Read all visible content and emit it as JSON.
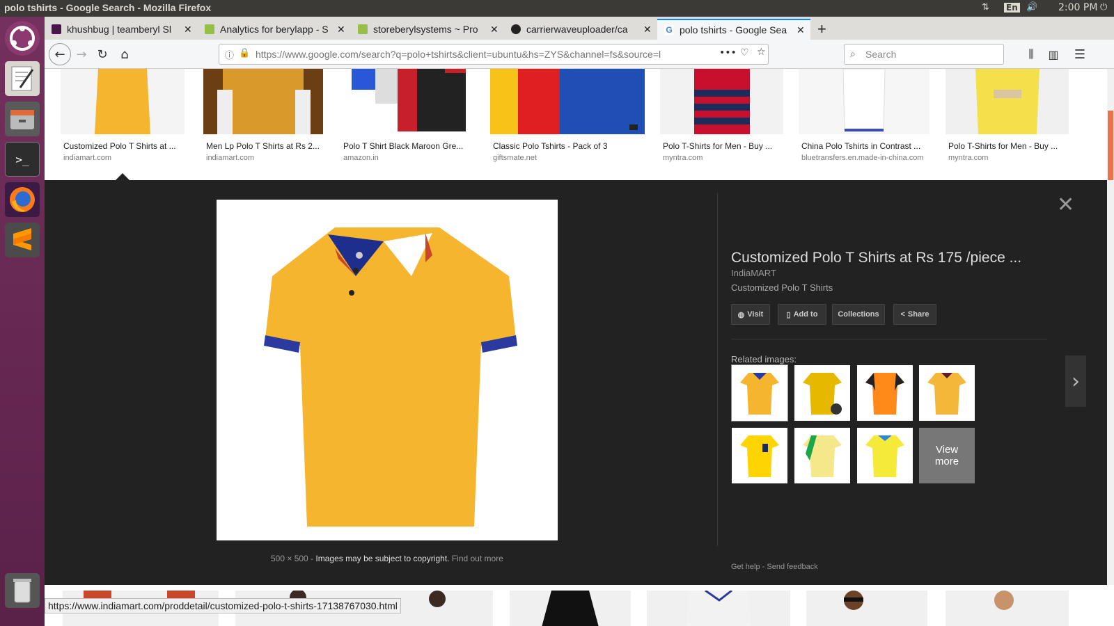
{
  "window": {
    "title": "polo tshirts - Google Search - Mozilla Firefox",
    "time": "2:00 PM",
    "lang": "En"
  },
  "tabs": [
    {
      "label": "khushbug | teamberyl Sl",
      "favicon_color": "#4a154b"
    },
    {
      "label": "Analytics for berylapp - S",
      "favicon_color": "#95bf47"
    },
    {
      "label": "storeberylsystems ~ Pro",
      "favicon_color": "#95bf47"
    },
    {
      "label": "carrierwaveuploader/ca",
      "favicon_color": "#222222"
    },
    {
      "label": "polo tshirts - Google Sea",
      "favicon_color": "#4285f4"
    }
  ],
  "nav": {
    "url": "https://www.google.com/search?q=polo+tshirts&client=ubuntu&hs=ZYS&channel=fs&source=l",
    "search_placeholder": "Search"
  },
  "results_top": [
    {
      "caption": "Customized Polo T Shirts at ...",
      "domain": "indiamart.com"
    },
    {
      "caption": "Men Lp Polo T Shirts at Rs 2...",
      "domain": "indiamart.com"
    },
    {
      "caption": "Polo T Shirt Black Maroon Gre...",
      "domain": "amazon.in"
    },
    {
      "caption": "Classic Polo Tshirts - Pack of 3",
      "domain": "giftsmate.net"
    },
    {
      "caption": "Polo T-Shirts for Men - Buy ...",
      "domain": "myntra.com"
    },
    {
      "caption": "China Polo Tshirts in Contrast ...",
      "domain": "bluetransfers.en.made-in-china.com"
    },
    {
      "caption": "Polo T-Shirts for Men - Buy ...",
      "domain": "myntra.com"
    }
  ],
  "panel": {
    "title": "Customized Polo T Shirts at Rs 175 /piece ...",
    "source": "IndiaMART",
    "description": "Customized Polo T Shirts",
    "buttons": {
      "visit": "Visit",
      "add_to": "Add to",
      "collections": "Collections",
      "share": "Share"
    },
    "related_label": "Related images:",
    "view_more": "View more",
    "dimensions": "500 × 500",
    "copyright": "Images may be subject to copyright.",
    "find_out_more": "Find out more",
    "get_help": "Get help",
    "send_feedback": "Send feedback"
  },
  "status_url": "https://www.indiamart.com/proddetail/customized-polo-t-shirts-17138767030.html",
  "colors": {
    "accent": "#0a84ff",
    "launcher": "#6a2a57",
    "panel": "#222222",
    "shirt_yellow": "#f5b52e"
  }
}
